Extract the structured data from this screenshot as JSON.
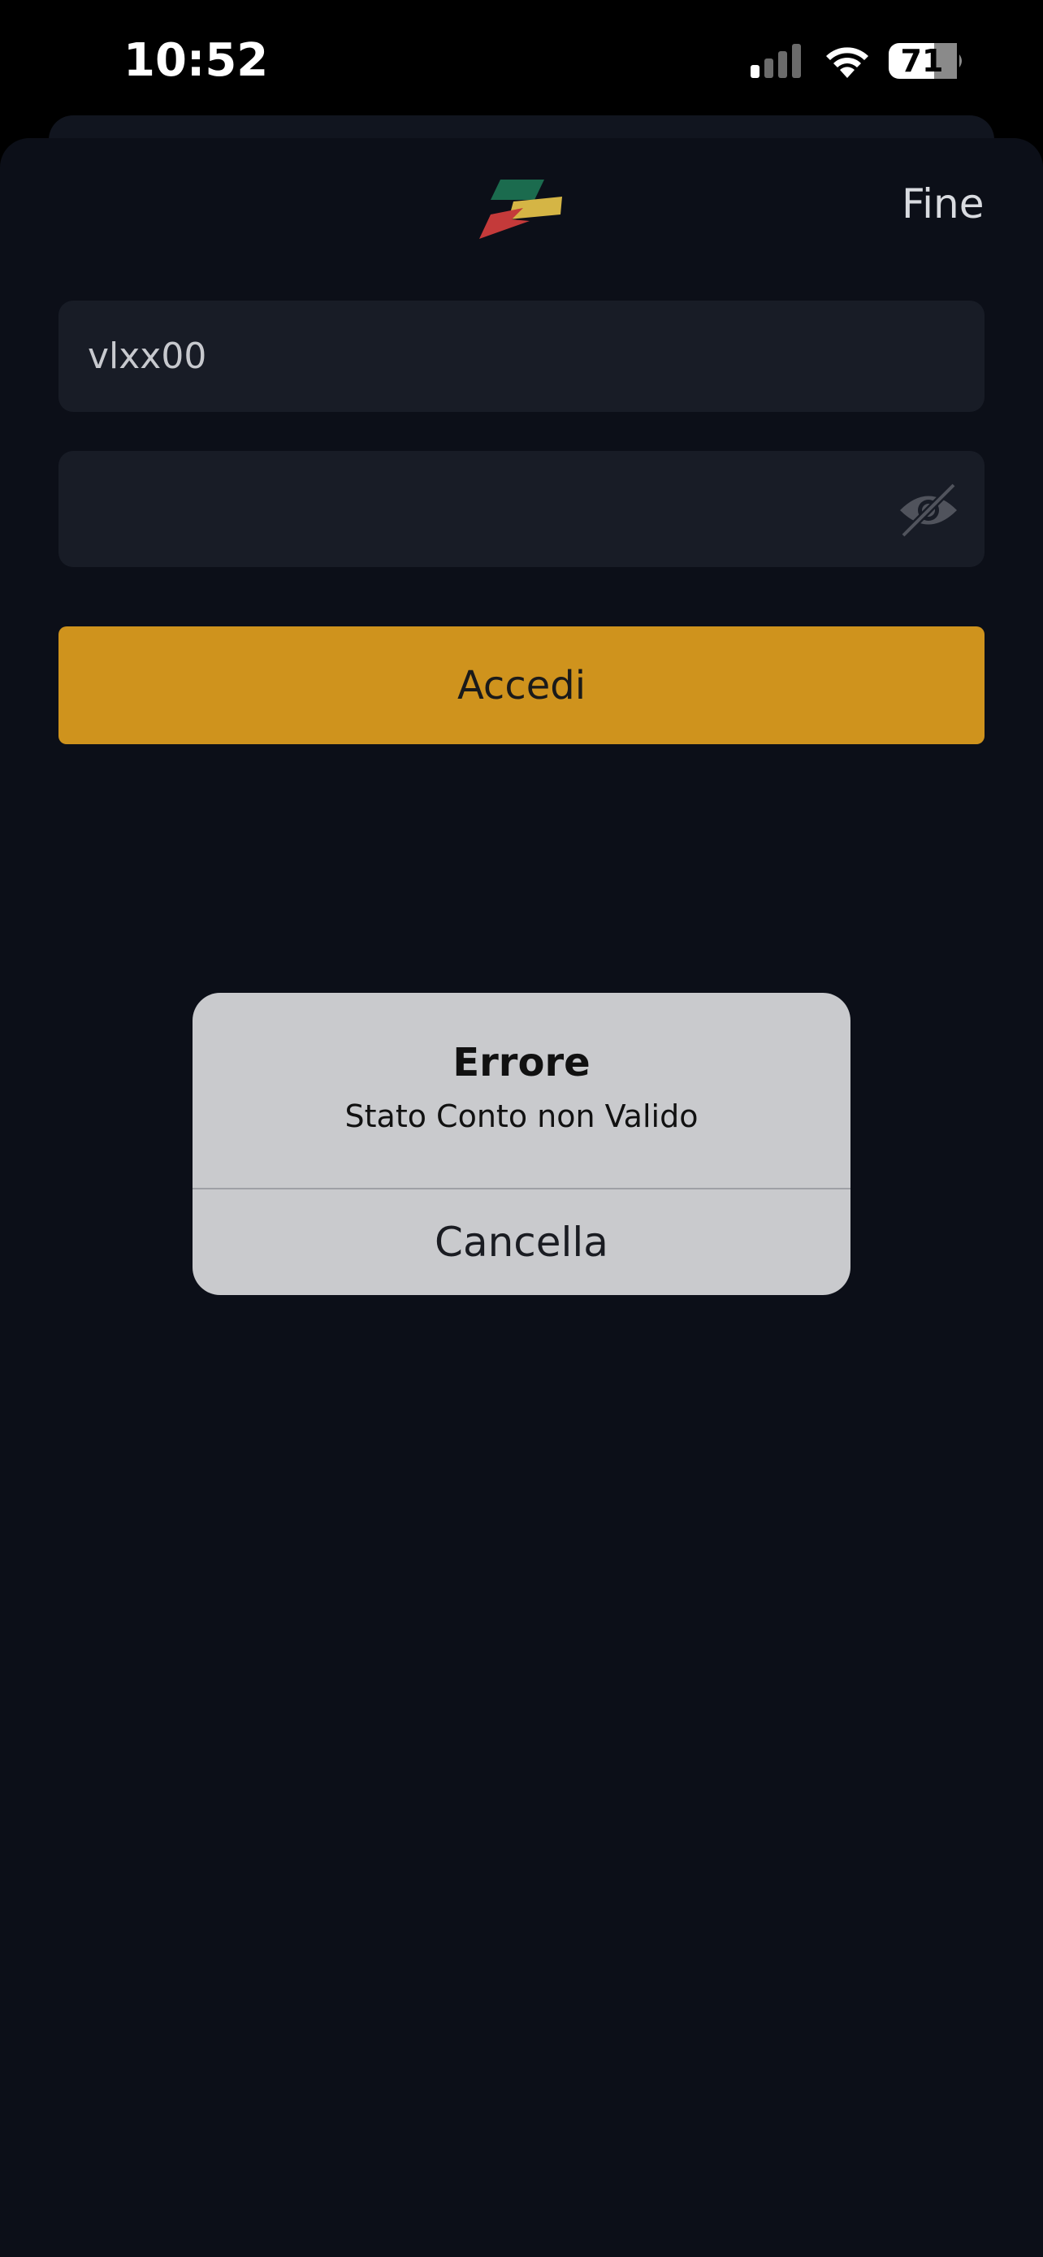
{
  "status_bar": {
    "time": "10:52",
    "battery": "71"
  },
  "header": {
    "logo_icon": "app-logo-icon",
    "done_label": "Fine"
  },
  "login_form": {
    "username_value": "vlxx00",
    "password_value": "",
    "password_toggle_icon": "eye-off-icon",
    "submit_label": "Accedi",
    "accent_color": "#cf931d"
  },
  "alert": {
    "title": "Errore",
    "message": "Stato Conto non Valido",
    "cancel_label": "Cancella"
  }
}
